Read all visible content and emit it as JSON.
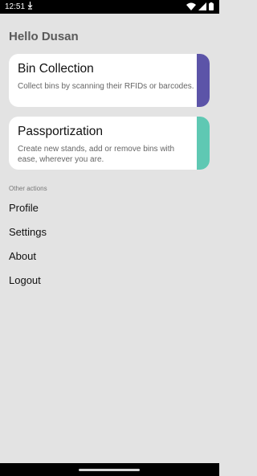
{
  "status_bar": {
    "time": "12:51",
    "extra_icon": "download-icon",
    "wifi_icon": "wifi-icon",
    "signal_icon": "cell-signal-icon",
    "battery_icon": "battery-icon"
  },
  "header": {
    "greeting": "Hello Dusan"
  },
  "cards": {
    "bin_collection": {
      "title": "Bin Collection",
      "description": "Collect bins by scanning their RFIDs or barcodes.",
      "accent_color": "#5c54a8"
    },
    "passportization": {
      "title": "Passportization",
      "description": "Create new stands, add or remove bins with ease, wherever you are.",
      "accent_color": "#5fc8b3"
    }
  },
  "other_actions": {
    "label": "Other actions",
    "items": [
      "Profile",
      "Settings",
      "About",
      "Logout"
    ]
  },
  "colors": {
    "background": "#e3e3e3",
    "card": "#ffffff"
  }
}
